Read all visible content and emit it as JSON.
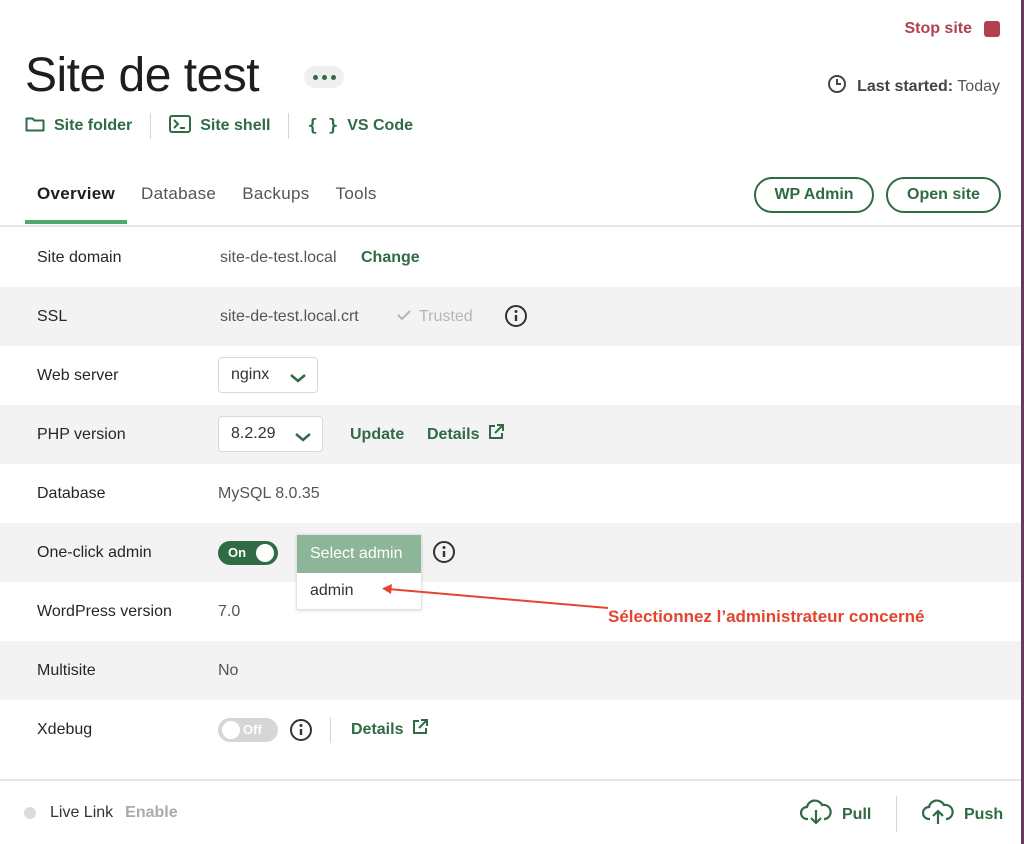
{
  "header": {
    "stop_label": "Stop site",
    "title": "Site de test",
    "last_started_label": "Last started:",
    "last_started_value": "Today"
  },
  "quicklinks": [
    {
      "label": "Site folder",
      "icon": "folder-icon"
    },
    {
      "label": "Site shell",
      "icon": "terminal-icon"
    },
    {
      "label": "VS Code",
      "icon": "code-braces-icon"
    }
  ],
  "tabs": [
    {
      "label": "Overview",
      "active": true
    },
    {
      "label": "Database",
      "active": false
    },
    {
      "label": "Backups",
      "active": false
    },
    {
      "label": "Tools",
      "active": false
    }
  ],
  "actions": {
    "wp_admin": "WP Admin",
    "open_site": "Open site"
  },
  "rows": {
    "site_domain": {
      "label": "Site domain",
      "value": "site-de-test.local",
      "action": "Change"
    },
    "ssl": {
      "label": "SSL",
      "value": "site-de-test.local.crt",
      "status": "Trusted"
    },
    "web_server": {
      "label": "Web server",
      "value": "nginx"
    },
    "php_version": {
      "label": "PHP version",
      "value": "8.2.29",
      "update": "Update",
      "details": "Details"
    },
    "database": {
      "label": "Database",
      "value": "MySQL 8.0.35"
    },
    "one_click_admin": {
      "label": "One-click admin",
      "toggle": "On",
      "select_placeholder": "Select admin",
      "option": "admin"
    },
    "wordpress_version": {
      "label": "WordPress version",
      "value": "7.0"
    },
    "multisite": {
      "label": "Multisite",
      "value": "No"
    },
    "xdebug": {
      "label": "Xdebug",
      "toggle": "Off",
      "details": "Details"
    }
  },
  "annotation": "Sélectionnez l’administrateur concerné",
  "footer": {
    "live_link": "Live Link",
    "enable": "Enable",
    "pull": "Pull",
    "push": "Push"
  },
  "colors": {
    "accent": "#2f6b45",
    "stop": "#b0424f",
    "annotation": "#e6442e"
  }
}
